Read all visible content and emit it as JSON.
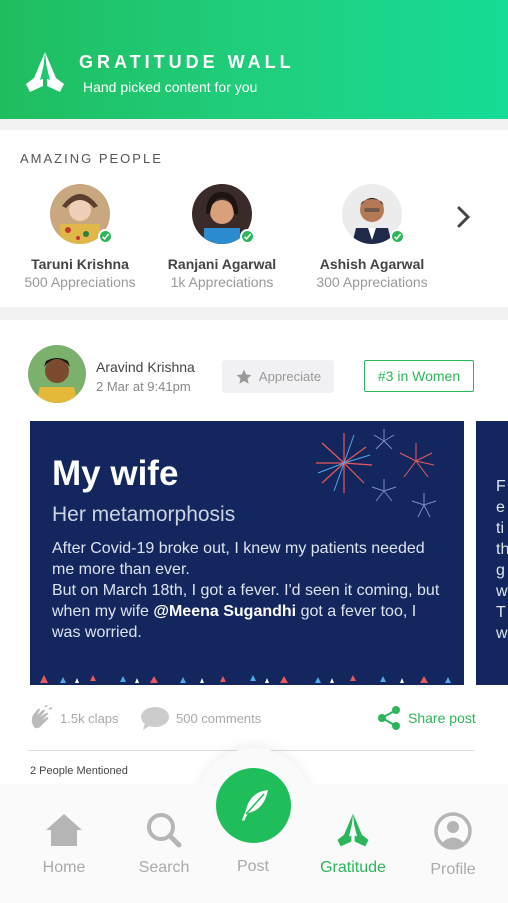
{
  "header": {
    "title": "GRATITUDE WALL",
    "subtitle": "Hand picked content for you"
  },
  "amazing_people": {
    "section_title": "AMAZING PEOPLE",
    "people": [
      {
        "name": "Taruni Krishna",
        "appreciations": "500 Appreciations"
      },
      {
        "name": "Ranjani Agarwal",
        "appreciations": "1k Appreciations"
      },
      {
        "name": "Ashish Agarwal",
        "appreciations": "300 Appreciations"
      }
    ]
  },
  "post": {
    "author_name": "Aravind Krishna",
    "date": "2 Mar at 9:41pm",
    "appreciate_label": "Appreciate",
    "rank_badge": "#3 in Women",
    "image_title": "My wife",
    "image_subtitle": "Her metamorphosis",
    "image_body_1": "After Covid-19 broke out, I knew my patients needed me more than ever.",
    "image_body_2": "But on March 18th, I got a fever. I'd seen it coming, but when my wife",
    "image_mention": "@Meena Sugandhi",
    "image_body_3": "got a fever too, I was worried.",
    "claps": "1.5k claps",
    "comments": "500 comments",
    "share_label": "Share post",
    "mentioned": "2 People Mentioned"
  },
  "next_post_preview": {
    "visible_letters": "F\ne\nti\nth\ng\nw\nT\nw"
  },
  "bottom_nav": {
    "items": [
      {
        "label": "Home"
      },
      {
        "label": "Search"
      },
      {
        "label": "Post"
      },
      {
        "label": "Gratitude"
      },
      {
        "label": "Profile"
      }
    ],
    "active": "Gratitude"
  },
  "colors": {
    "accent": "#2cb55a",
    "header_gradient_start": "#1fbd5f",
    "header_gradient_end": "#16dc96",
    "post_image_bg": "#13275e"
  }
}
